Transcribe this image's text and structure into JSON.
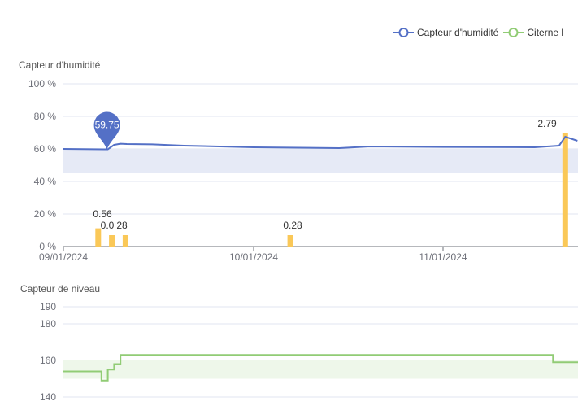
{
  "legend": [
    {
      "name": "Capteur d'humidité",
      "color": "#5470c6",
      "icon": "line-circle-icon"
    },
    {
      "name": "Citerne l",
      "color": "#91cc75",
      "icon": "line-circle-icon"
    }
  ],
  "chart_data": [
    {
      "type": "line",
      "title": "Capteur d'humidité",
      "x_ticks": [
        "09/01/2024",
        "10/01/2024",
        "11/01/2024"
      ],
      "y_ticks": [
        "100 %",
        "80 %",
        "60 %",
        "40 %",
        "20 %",
        "0 %"
      ],
      "ylim": [
        0,
        100
      ],
      "grid": true,
      "series": [
        {
          "name": "Capteur d'humidité",
          "type": "line",
          "color": "#5470c6",
          "x": [
            "2024-09-01",
            "2024-09-08",
            "2024-09-09",
            "2024-09-10",
            "2024-09-11",
            "2024-09-15",
            "2024-09-20",
            "2024-10-01",
            "2024-10-15",
            "2024-10-20",
            "2024-11-01",
            "2024-11-16",
            "2024-11-20",
            "2024-11-21",
            "2024-11-23"
          ],
          "values": [
            60.0,
            59.75,
            62.5,
            63.2,
            63.0,
            62.8,
            62.0,
            61.0,
            60.5,
            61.5,
            61.2,
            61.0,
            62.0,
            67.5,
            65.0
          ]
        },
        {
          "name": "Capteur d'humidité",
          "type": "bar",
          "color": "#fac858",
          "x": [
            "2024-09-07",
            "2024-09-08",
            "2024-09-09",
            "2024-10-07",
            "2024-11-21"
          ],
          "values": [
            0.56,
            0.2,
            0.28,
            0.28,
            2.79
          ],
          "labels": [
            "0.56",
            "0.0",
            "28",
            "0.28",
            "2.79"
          ]
        }
      ],
      "mark_point": {
        "label": "59.75",
        "x": "2024-09-08",
        "y": 59.75,
        "color": "#5470c6"
      },
      "mark_area": {
        "y": [
          45,
          60
        ],
        "color": "#e6eaf6"
      }
    },
    {
      "type": "line",
      "title": "Capteur de niveau",
      "y_ticks": [
        "190",
        "180",
        "160",
        "140"
      ],
      "grid": true,
      "series": [
        {
          "name": "Citerne l",
          "type": "step",
          "color": "#91cc75",
          "x": [
            "2024-09-01",
            "2024-09-07",
            "2024-09-08",
            "2024-09-09",
            "2024-09-10",
            "2024-11-19",
            "2024-11-25",
            "2024-11-30"
          ],
          "values": [
            154,
            149,
            155,
            158,
            163,
            159,
            163,
            163
          ]
        }
      ],
      "mark_area": {
        "y": [
          150,
          160
        ],
        "color": "#eef7ea"
      }
    }
  ]
}
